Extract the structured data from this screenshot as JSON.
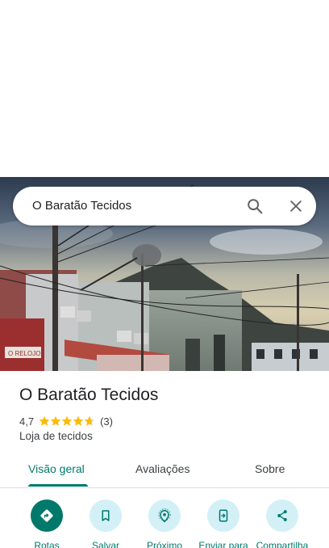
{
  "search": {
    "query": "O Baratão Tecidos"
  },
  "photo": {
    "sign_text": "O RELOJO"
  },
  "place": {
    "name": "O Baratão Tecidos",
    "rating": "4,7",
    "rating_value": 4.7,
    "review_count": "(3)",
    "category": "Loja de tecidos"
  },
  "tabs": [
    {
      "label": "Visão geral",
      "active": true
    },
    {
      "label": "Avaliações",
      "active": false
    },
    {
      "label": "Sobre",
      "active": false
    }
  ],
  "actions": [
    {
      "label": "Rotas",
      "icon": "directions-icon"
    },
    {
      "label": "Salvar",
      "icon": "bookmark-icon"
    },
    {
      "label": "Próximo",
      "icon": "nearby-icon"
    },
    {
      "label": "Enviar para",
      "icon": "send-to-phone-icon"
    },
    {
      "label": "Compartilha",
      "icon": "share-icon"
    }
  ],
  "colors": {
    "accent": "#00796b",
    "action_circle": "#d3f0f7",
    "star": "#fbbc04"
  }
}
